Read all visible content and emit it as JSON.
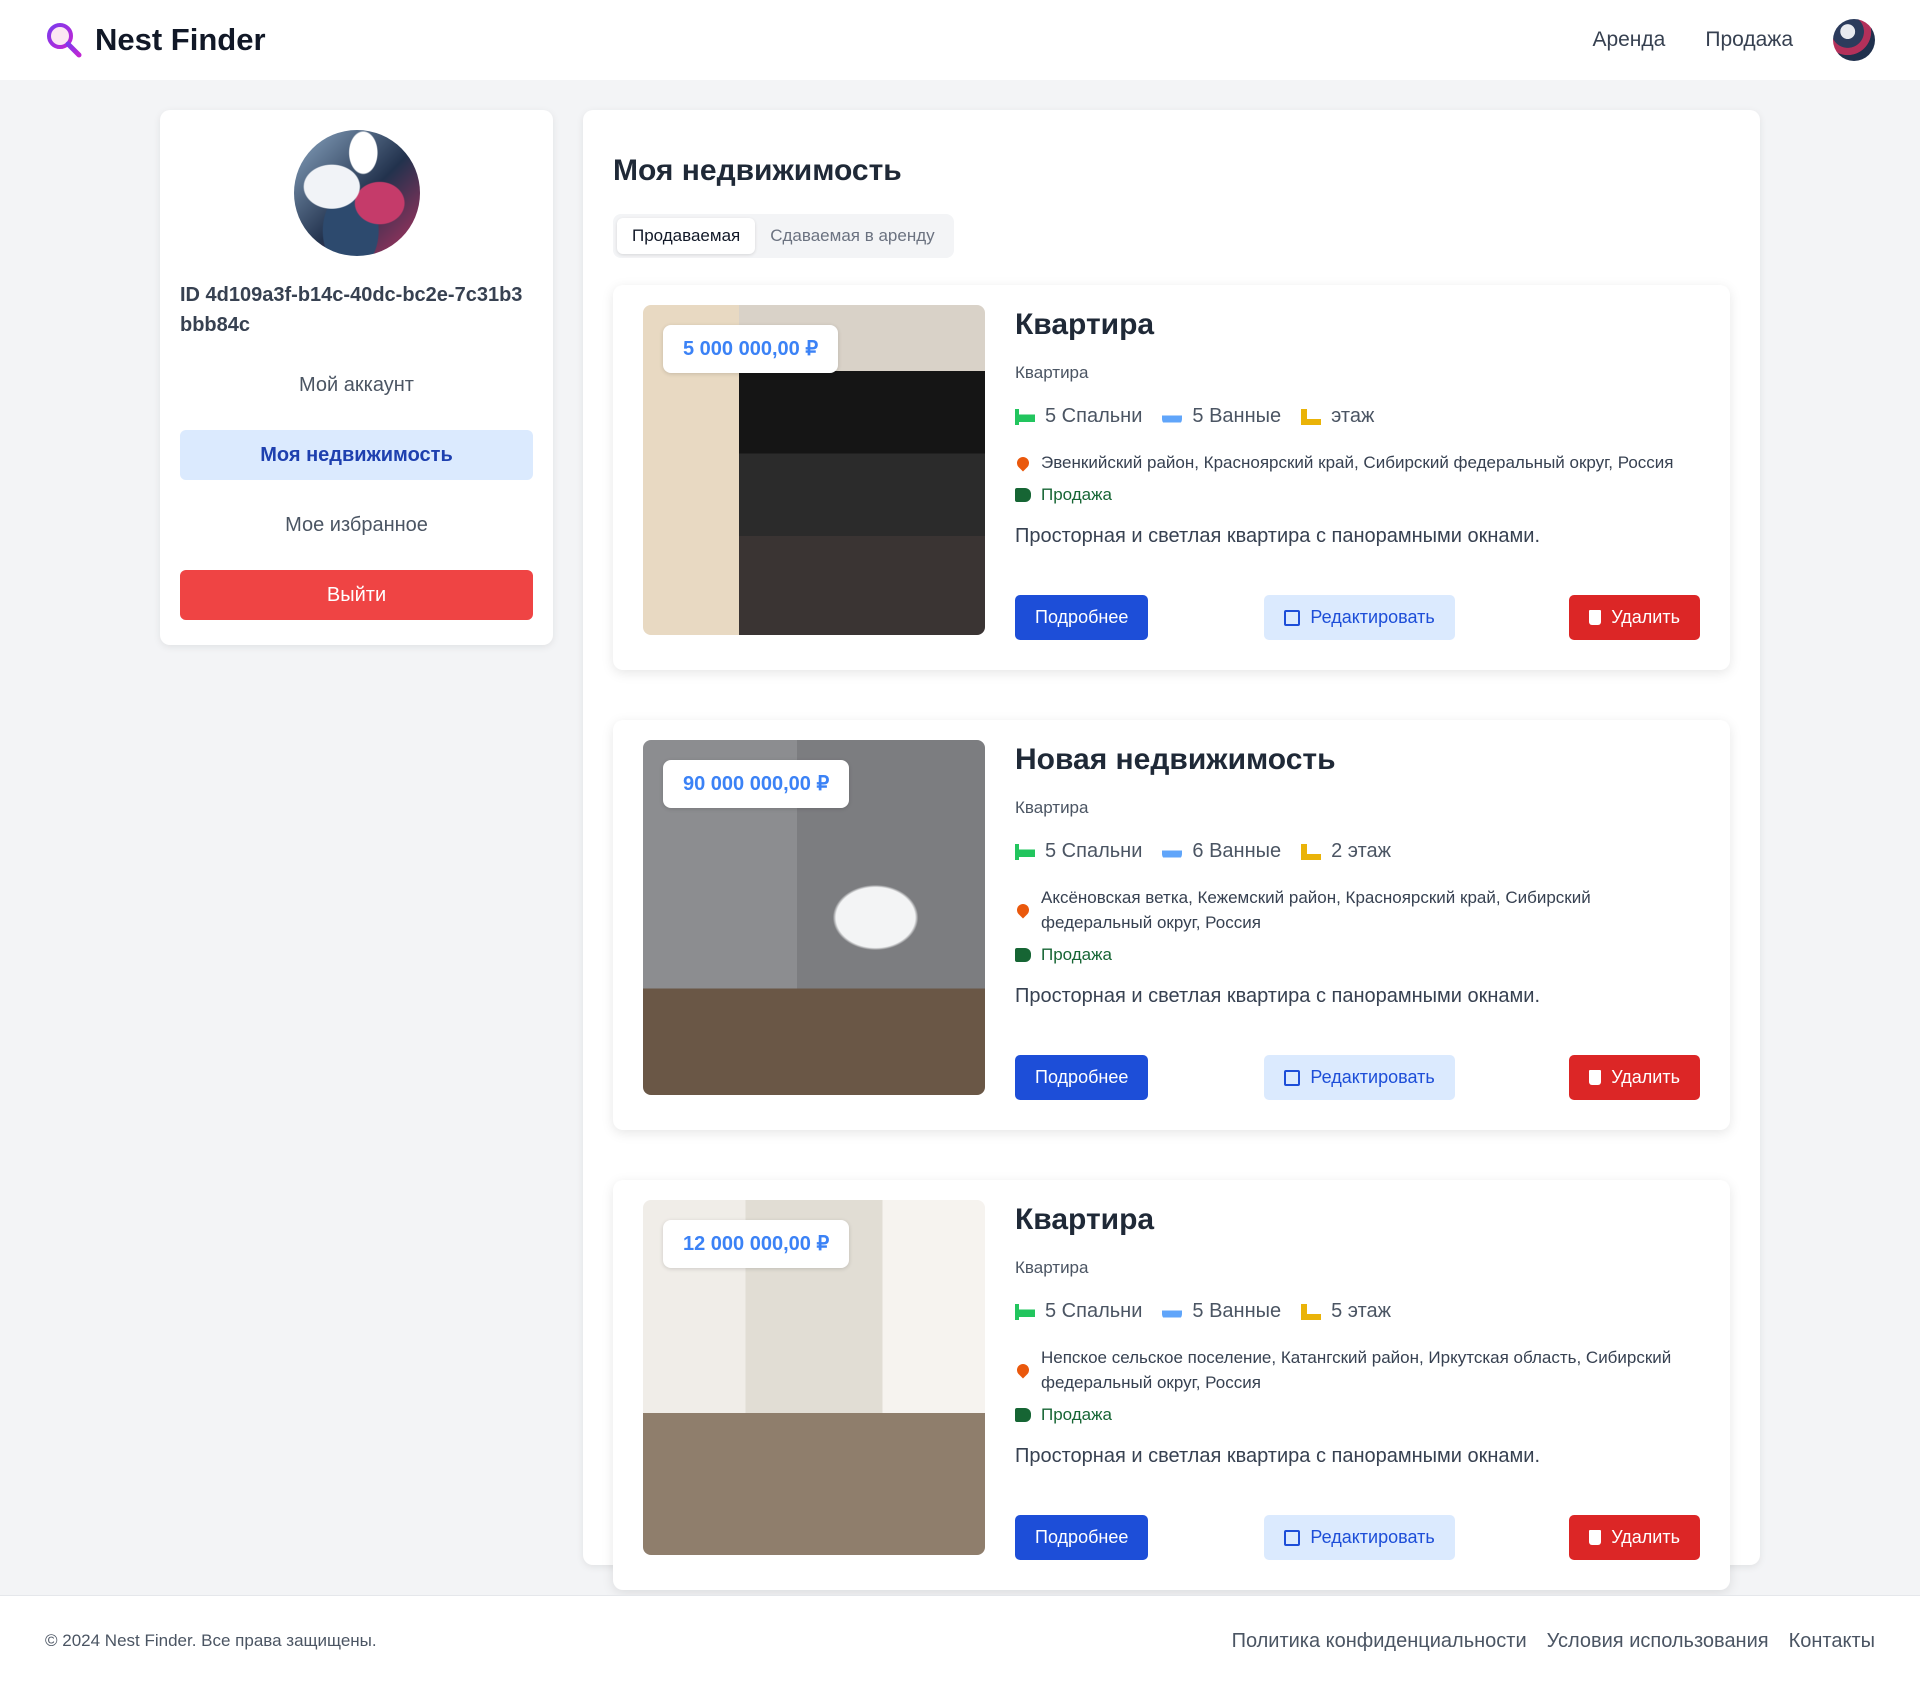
{
  "header": {
    "logo_text": "Nest Finder",
    "nav": [
      "Аренда",
      "Продажа"
    ]
  },
  "sidebar": {
    "user_id": "ID 4d109a3f-b14c-40dc-bc2e-7c31b3bbb84c",
    "items": [
      {
        "label": "Мой аккаунт"
      },
      {
        "label": "Моя недвижимость"
      },
      {
        "label": "Мое избранное"
      }
    ],
    "logout_label": "Выйти"
  },
  "main": {
    "title": "Моя недвижимость",
    "tabs": [
      "Продаваемая",
      "Сдаваемая в аренду"
    ],
    "listings": [
      {
        "price": "5 000 000,00 ₽",
        "title": "Квартира",
        "type": "Квартира",
        "bedrooms": "5 Спальни",
        "bathrooms": "5 Ванные",
        "floor": "этаж",
        "location": "Эвенкийский район, Красноярский край, Сибирский федеральный округ, Россия",
        "deal": "Продажа",
        "description": "Просторная и светлая квартира с панорамными окнами.",
        "details_label": "Подробнее",
        "edit_label": "Редактировать",
        "delete_label": "Удалить"
      },
      {
        "price": "90 000 000,00 ₽",
        "title": "Новая недвижимость",
        "type": "Квартира",
        "bedrooms": "5 Спальни",
        "bathrooms": "6 Ванные",
        "floor": "2 этаж",
        "location": "Аксёновская ветка, Кежемский район, Красноярский край, Сибирский федеральный округ, Россия",
        "deal": "Продажа",
        "description": "Просторная и светлая квартира с панорамными окнами.",
        "details_label": "Подробнее",
        "edit_label": "Редактировать",
        "delete_label": "Удалить"
      },
      {
        "price": "12 000 000,00 ₽",
        "title": "Квартира",
        "type": "Квартира",
        "bedrooms": "5 Спальни",
        "bathrooms": "5 Ванные",
        "floor": "5 этаж",
        "location": "Непское сельское поселение, Катангский район, Иркутская область, Сибирский федеральный округ, Россия",
        "deal": "Продажа",
        "description": "Просторная и светлая квартира с панорамными окнами.",
        "details_label": "Подробнее",
        "edit_label": "Редактировать",
        "delete_label": "Удалить"
      }
    ]
  },
  "footer": {
    "copyright": "© 2024 Nest Finder. Все права защищены.",
    "links": [
      "Политика конфиденциальности",
      "Условия использования",
      "Контакты"
    ]
  },
  "colors": {
    "primary": "#1d4ed8",
    "danger": "#dc2626",
    "logout": "#ef4444",
    "accent_light": "#dbeafe",
    "price": "#3b82f6"
  }
}
